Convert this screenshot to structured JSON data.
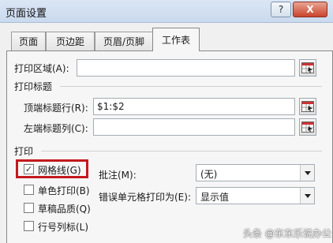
{
  "window": {
    "title": "页面设置",
    "help_label": "?",
    "close_label": "X"
  },
  "tabs": [
    {
      "label": "页面",
      "active": false
    },
    {
      "label": "页边距",
      "active": false
    },
    {
      "label": "页眉/页脚",
      "active": false
    },
    {
      "label": "工作表",
      "active": true
    }
  ],
  "print_area": {
    "label": "打印区域(A):",
    "value": ""
  },
  "print_titles": {
    "section_label": "打印标题",
    "top_rows_label": "顶端标题行(R):",
    "top_rows_value": "$1:$2",
    "left_cols_label": "左端标题列(C):",
    "left_cols_value": ""
  },
  "print": {
    "section_label": "打印",
    "options": [
      {
        "label": "网格线(G)",
        "checked": true
      },
      {
        "label": "单色打印(B)",
        "checked": false
      },
      {
        "label": "草稿品质(Q)",
        "checked": false
      },
      {
        "label": "行号列标(L)",
        "checked": false
      }
    ],
    "comments_label": "批注(M):",
    "comments_value": "(无)",
    "errors_label": "错误单元格打印为(E):",
    "errors_value": "显示值",
    "check_mark": "✓"
  },
  "watermark": "头条 @东东乐说办公"
}
